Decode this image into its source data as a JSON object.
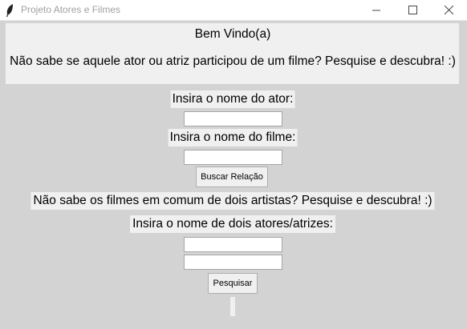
{
  "window": {
    "title": "Projeto Atores e Filmes",
    "icons": {
      "app": "feather-icon",
      "minimize": "minimize-icon",
      "maximize": "maximize-icon",
      "close": "close-icon"
    }
  },
  "welcome": {
    "heading": "Bem Vindo(a)",
    "subtitle": "Não sabe se aquele ator ou atriz participou de um filme? Pesquise e descubra! :)"
  },
  "relation_form": {
    "actor_label": "Insira o nome do ator:",
    "actor_value": "",
    "movie_label": "Insira o nome do filme:",
    "movie_value": "",
    "button_label": "Buscar Relação"
  },
  "common_form": {
    "intro": "Não sabe os filmes em comum de dois artistas? Pesquise e descubra! :)",
    "label": "Insira o nome de dois atores/atrizes:",
    "artist1_value": "",
    "artist2_value": "",
    "button_label": "Pesquisar"
  },
  "result": {
    "text": ""
  }
}
